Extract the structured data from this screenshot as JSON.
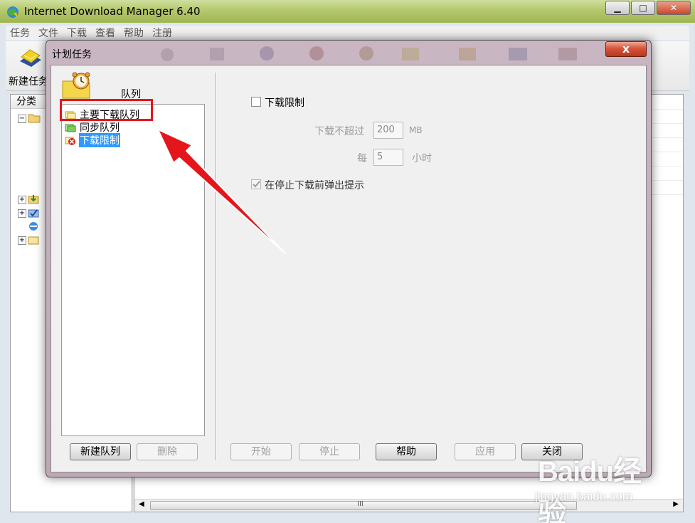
{
  "main_window": {
    "title": "Internet Download Manager 6.40",
    "menu": [
      "任务",
      "文件",
      "下载",
      "查看",
      "帮助",
      "注册"
    ],
    "toolbar": {
      "new_task_label": "新建任务"
    },
    "categories_header": "分类",
    "scroll_grip": "III"
  },
  "dialog": {
    "title": "计划任务",
    "close_glyph": "x",
    "queue_label": "队列",
    "queues": [
      {
        "name": "主要下载队列",
        "selected": false
      },
      {
        "name": "同步队列",
        "selected": false
      },
      {
        "name": "下载限制",
        "selected": true
      }
    ],
    "download_limit_checkbox": "下载限制",
    "not_exceed_label": "下载不超过",
    "not_exceed_value": "200",
    "not_exceed_unit": "MB",
    "every_label": "每",
    "every_value": "5",
    "every_unit": "小时",
    "prompt_checkbox": "在停止下载前弹出提示",
    "buttons": {
      "new_queue": "新建队列",
      "delete": "删除",
      "start": "开始",
      "stop": "停止",
      "help": "帮助",
      "apply": "应用",
      "close": "关闭"
    }
  },
  "watermark": {
    "brand": "Baidu经验",
    "url": "jingyan.baidu.com"
  }
}
